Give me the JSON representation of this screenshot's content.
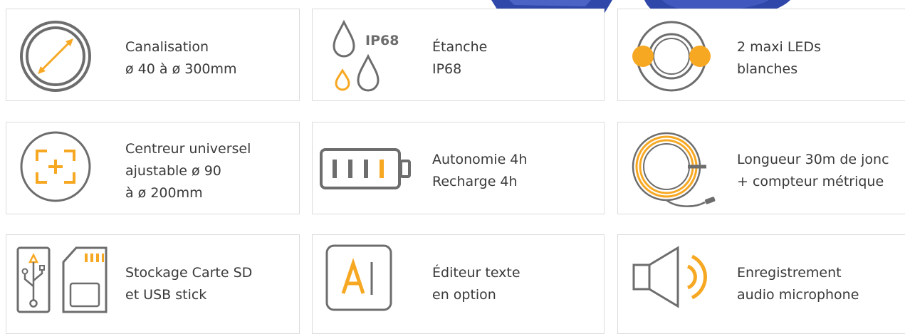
{
  "colors": {
    "accent": "#f7a823",
    "icon_gray": "#6d6d6d",
    "border": "#dcdcdc",
    "text": "#3a3a3a",
    "cable_blue": "#2e47a8"
  },
  "features": [
    {
      "id": "pipe",
      "icon": "pipe-diameter-icon",
      "lines": [
        "Canalisation",
        "ø 40 à ø 300mm"
      ]
    },
    {
      "id": "waterproof",
      "icon": "water-drops-icon",
      "badge": "IP68",
      "lines": [
        "Étanche",
        "IP68"
      ]
    },
    {
      "id": "leds",
      "icon": "camera-leds-icon",
      "lines": [
        "2 maxi LEDs",
        "blanches"
      ]
    },
    {
      "id": "centreur",
      "icon": "centering-target-icon",
      "lines": [
        "Centreur universel",
        "ajustable ø 90",
        "à ø 200mm"
      ]
    },
    {
      "id": "battery",
      "icon": "battery-icon",
      "lines": [
        "Autonomie 4h",
        "Recharge 4h"
      ]
    },
    {
      "id": "cable",
      "icon": "cable-reel-icon",
      "lines": [
        "Longueur 30m de jonc",
        "+ compteur métrique"
      ]
    },
    {
      "id": "storage",
      "icon": "usb-sd-card-icon",
      "lines": [
        "Stockage Carte SD",
        "et USB stick"
      ]
    },
    {
      "id": "editor",
      "icon": "text-editor-icon",
      "lines": [
        "Éditeur texte",
        "en option"
      ]
    },
    {
      "id": "audio",
      "icon": "speaker-audio-icon",
      "lines": [
        "Enregistrement",
        "audio microphone"
      ]
    }
  ]
}
